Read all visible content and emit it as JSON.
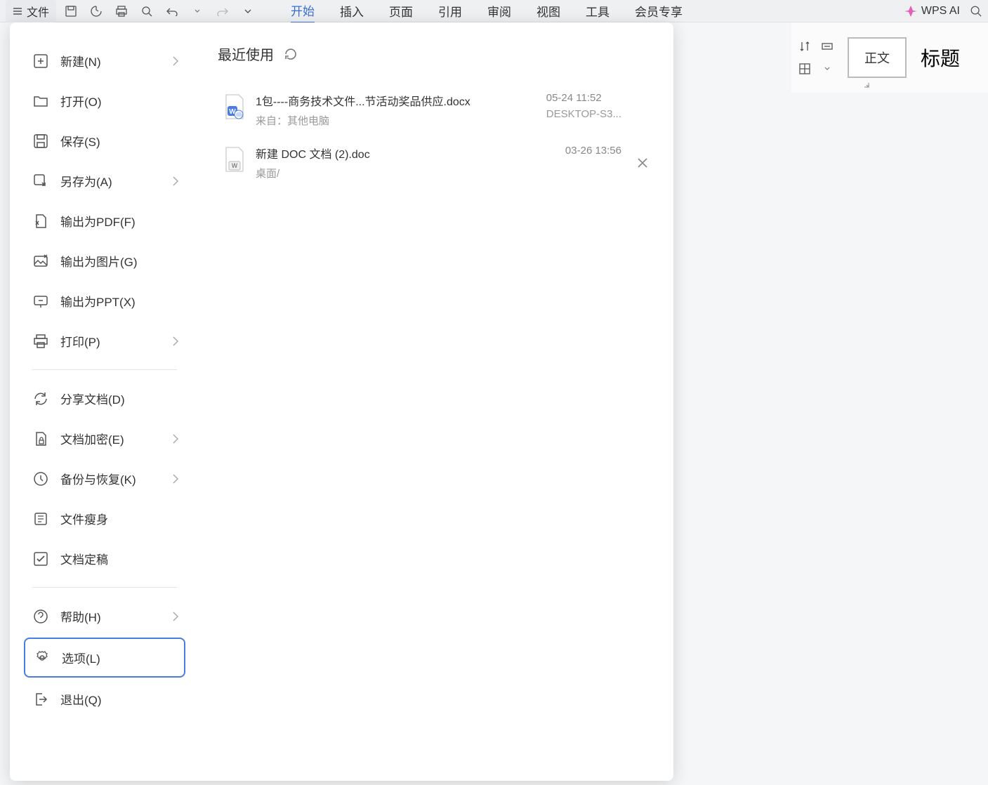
{
  "toolbar": {
    "file_label": "文件",
    "ai_label": "WPS AI"
  },
  "ribbon": {
    "tabs": [
      "开始",
      "插入",
      "页面",
      "引用",
      "审阅",
      "视图",
      "工具",
      "会员专享"
    ],
    "active_tab": "开始",
    "style_body": "正文",
    "style_title": "标题"
  },
  "sidebar": {
    "items": [
      {
        "label": "新建(N)",
        "icon": "new",
        "chevron": true
      },
      {
        "label": "打开(O)",
        "icon": "open",
        "chevron": false
      },
      {
        "label": "保存(S)",
        "icon": "save",
        "chevron": false
      },
      {
        "label": "另存为(A)",
        "icon": "saveas",
        "chevron": true
      },
      {
        "label": "输出为PDF(F)",
        "icon": "pdf",
        "chevron": false
      },
      {
        "label": "输出为图片(G)",
        "icon": "image",
        "chevron": false
      },
      {
        "label": "输出为PPT(X)",
        "icon": "ppt",
        "chevron": false
      },
      {
        "label": "打印(P)",
        "icon": "print",
        "chevron": true
      },
      {
        "label": "分享文档(D)",
        "icon": "share",
        "chevron": false
      },
      {
        "label": "文档加密(E)",
        "icon": "encrypt",
        "chevron": true
      },
      {
        "label": "备份与恢复(K)",
        "icon": "backup",
        "chevron": true
      },
      {
        "label": "文件瘦身",
        "icon": "slim",
        "chevron": false
      },
      {
        "label": "文档定稿",
        "icon": "finalize",
        "chevron": false
      },
      {
        "label": "帮助(H)",
        "icon": "help",
        "chevron": true
      },
      {
        "label": "选项(L)",
        "icon": "options",
        "chevron": false
      },
      {
        "label": "退出(Q)",
        "icon": "exit",
        "chevron": false
      }
    ]
  },
  "recent": {
    "title": "最近使用",
    "items": [
      {
        "name": "1包----商务技术文件...节活动奖品供应.docx",
        "meta": "来自：其他电脑",
        "time": "05-24 11:52",
        "location": "DESKTOP-S3...",
        "icon_type": "cloud"
      },
      {
        "name": "新建 DOC 文档 (2).doc",
        "meta": "桌面/",
        "time": "03-26 13:56",
        "location": "",
        "icon_type": "local"
      }
    ]
  }
}
